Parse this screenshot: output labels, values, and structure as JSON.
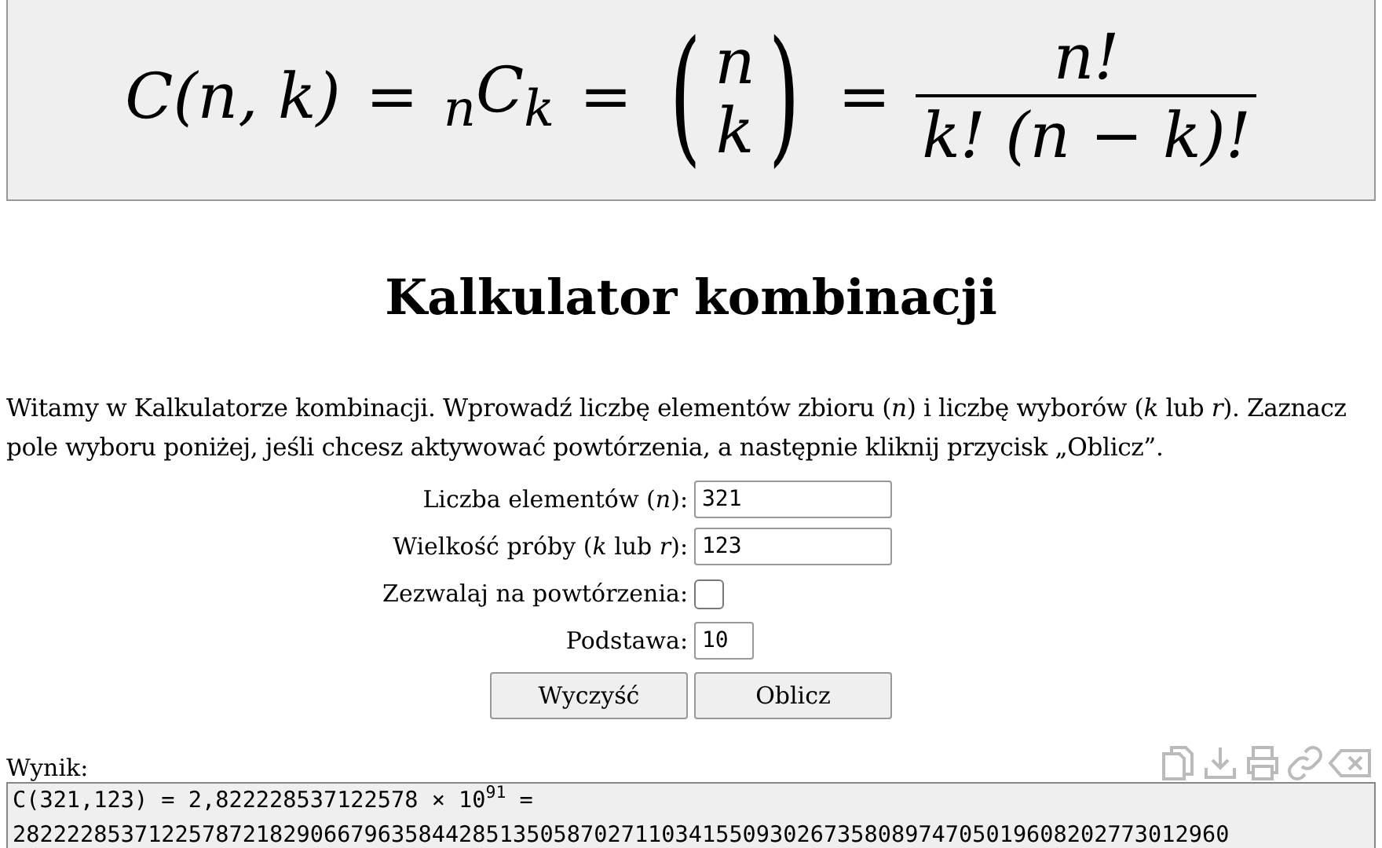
{
  "formula": {
    "items": [
      {
        "kind": "text",
        "text": "C(n, k)"
      },
      {
        "kind": "op",
        "text": "="
      },
      {
        "kind": "text",
        "text": "$_{n}$C$_{k}$"
      },
      {
        "kind": "op",
        "text": "="
      },
      {
        "kind": "binomial",
        "open": "(",
        "top": "n",
        "bottom": "k",
        "close": ")"
      },
      {
        "kind": "op",
        "text": "="
      },
      {
        "kind": "fraction",
        "numerator": "n!",
        "denominator": "k! (n − k)!"
      }
    ]
  },
  "title": "Kalkulator kombinacji",
  "intro": "Witamy w Kalkulatorze kombinacji. Wprowadź liczbę elementów zbioru (*n*) i liczbę wyborów (*k* lub *r*). Zaznacz pole wyboru poniżej, jeśli chcesz aktywować powtórzenia, a następnie kliknij przycisk „Oblicz”.",
  "fields": [
    {
      "kind": "text",
      "label": "Liczba elementów (*n*):",
      "value": "321"
    },
    {
      "kind": "text",
      "label": "Wielkość próby (*k* lub *r*):",
      "value": "123"
    },
    {
      "kind": "checkbox",
      "label": "Zezwalaj na powtórzenia:",
      "checked": false
    },
    {
      "kind": "short",
      "label": "Podstawa:",
      "value": "10"
    }
  ],
  "buttons": [
    "Wyczyść",
    "Oblicz"
  ],
  "result": {
    "label": "Wynik:",
    "lines": [
      "C(321,123) = 2,822228537122578 × 10$^{91}$ =",
      "282222853712257872182906679635844285135058702711034155093026735808974705019608202773012960"
    ]
  }
}
